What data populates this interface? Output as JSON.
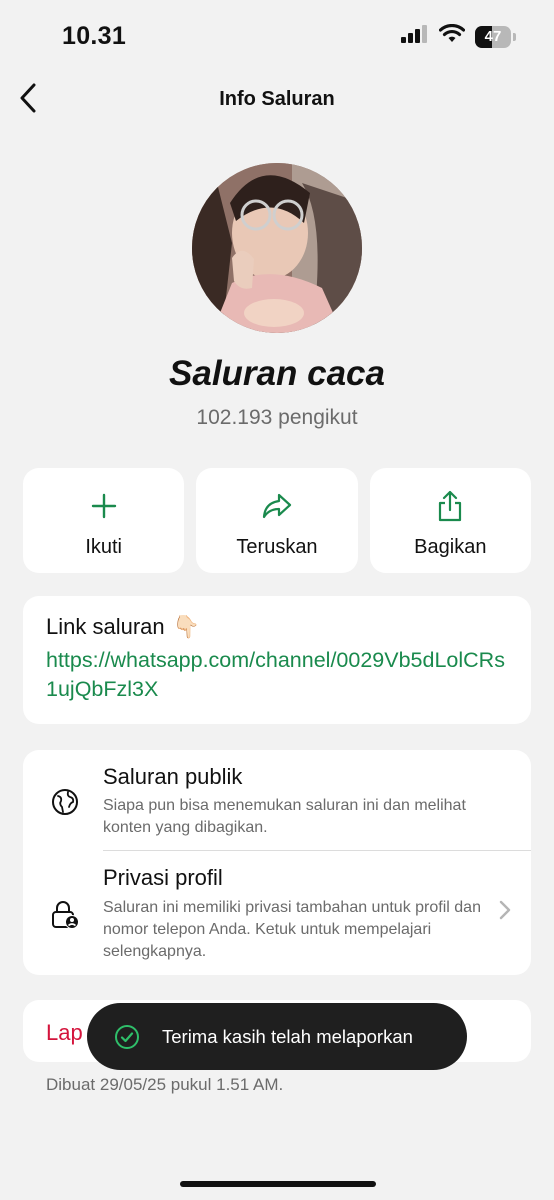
{
  "status_bar": {
    "time": "10.31",
    "battery_level": 47,
    "battery_text": "47"
  },
  "nav": {
    "title": "Info Saluran"
  },
  "channel": {
    "name": "Saluran caca",
    "followers": "102.193 pengikut"
  },
  "actions": [
    {
      "label": "Ikuti",
      "icon": "plus-icon"
    },
    {
      "label": "Teruskan",
      "icon": "forward-icon"
    },
    {
      "label": "Bagikan",
      "icon": "share-icon"
    }
  ],
  "link": {
    "title": "Link saluran",
    "emoji": "👇🏻",
    "url": "https://whatsapp.com/channel/0029Vb5dLolCRs1ujQbFzl3X"
  },
  "settings": {
    "public": {
      "title": "Saluran publik",
      "description": "Siapa pun bisa menemukan saluran ini dan melihat konten yang dibagikan.",
      "icon": "globe-icon"
    },
    "privacy": {
      "title": "Privasi profil",
      "description": "Saluran ini memiliki privasi tambahan untuk profil dan nomor telepon Anda. Ketuk untuk mempelajari selengkapnya.",
      "icon": "lock-person-icon"
    }
  },
  "report": {
    "label": "Lap"
  },
  "created": "Dibuat 29/05/25 pukul 1.51 AM.",
  "toast": {
    "text": "Terima kasih telah melaporkan",
    "icon": "check-circle-icon"
  },
  "colors": {
    "accent_green": "#1a8a4d",
    "report_red": "#d4143c",
    "background": "#f2f2f2"
  }
}
